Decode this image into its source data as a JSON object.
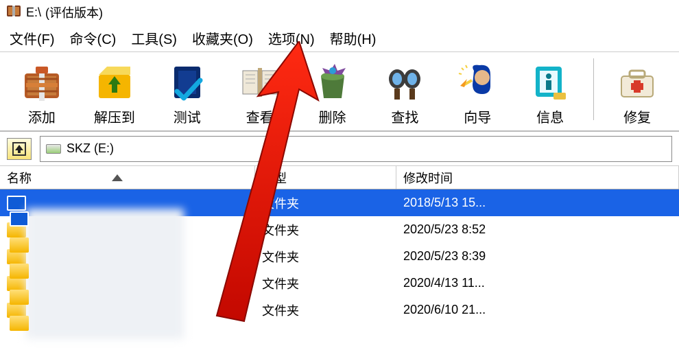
{
  "title_path": "E:\\",
  "title_suffix": "(评估版本)",
  "menu": {
    "file": "文件(F)",
    "command": "命令(C)",
    "tools": "工具(S)",
    "favorites": "收藏夹(O)",
    "options": "选项(N)",
    "help": "帮助(H)"
  },
  "toolbar": {
    "add": "添加",
    "extract": "解压到",
    "test": "测试",
    "view": "查看",
    "delete": "删除",
    "find": "查找",
    "wizard": "向导",
    "info": "信息",
    "repair": "修复"
  },
  "pathbar": {
    "drive_label": "SKZ (E:)"
  },
  "columns": {
    "name": "名称",
    "type": "类型",
    "modified": "修改时间"
  },
  "rows": [
    {
      "name": "",
      "type": "文件夹",
      "modified": "2018/5/13 15...",
      "selected": true
    },
    {
      "name": "",
      "type": "文件夹",
      "modified": "2020/5/23 8:52",
      "selected": false
    },
    {
      "name": "",
      "type": "文件夹",
      "modified": "2020/5/23 8:39",
      "selected": false
    },
    {
      "name": "",
      "type": "文件夹",
      "modified": "2020/4/13 11...",
      "selected": false
    },
    {
      "name": "",
      "type": "文件夹",
      "modified": "2020/6/10 21...",
      "selected": false
    }
  ]
}
